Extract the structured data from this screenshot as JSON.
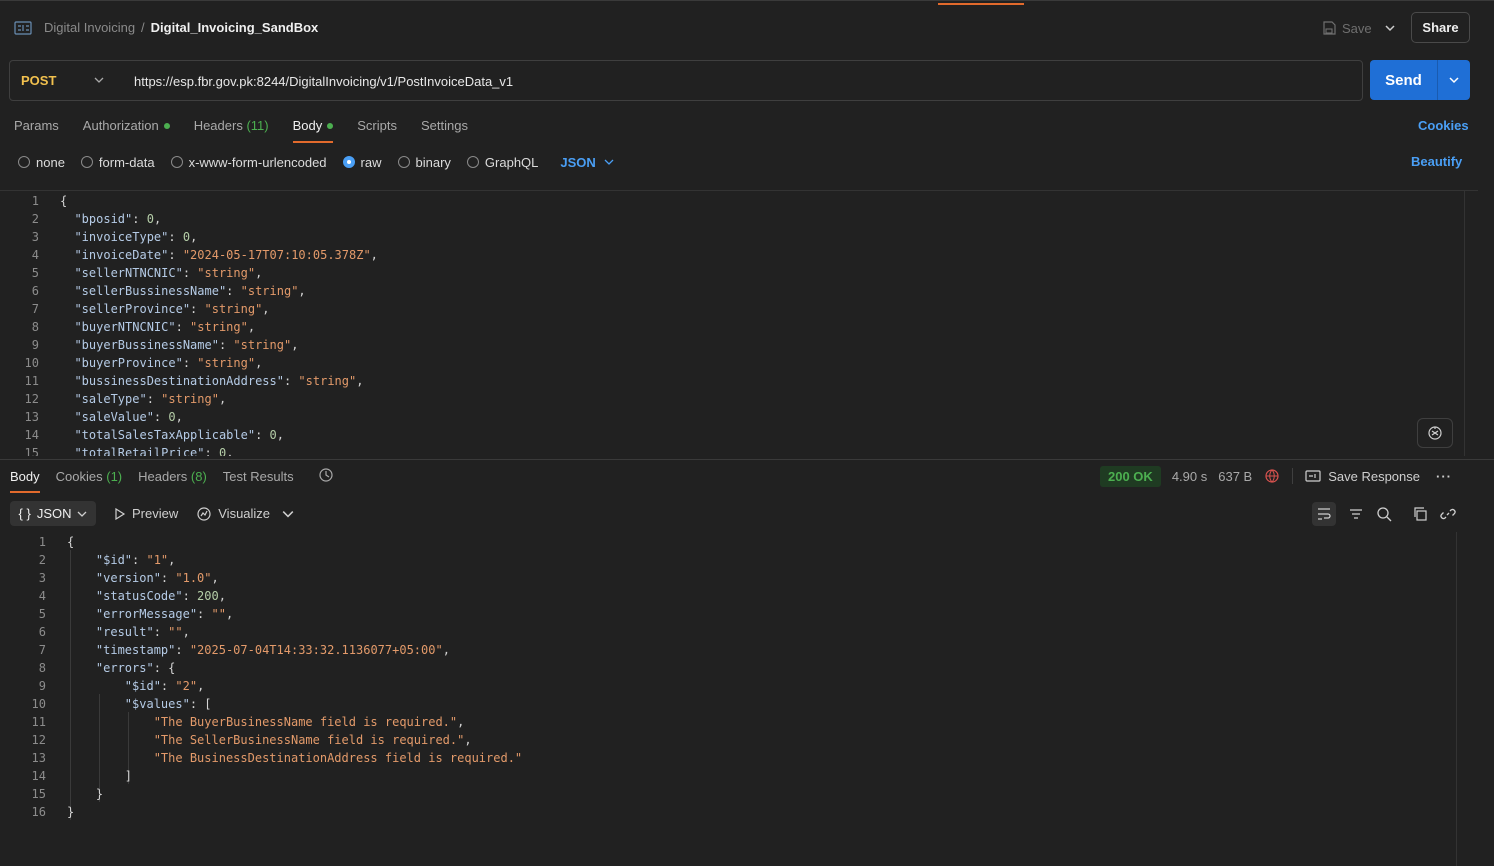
{
  "header": {
    "workspace": "Digital Invoicing",
    "separator": "/",
    "request_name": "Digital_Invoicing_SandBox",
    "save_label": "Save",
    "share_label": "Share"
  },
  "request": {
    "method": "POST",
    "url": "https://esp.fbr.gov.pk:8244/DigitalInvoicing/v1/PostInvoiceData_v1",
    "send_label": "Send"
  },
  "request_tabs": {
    "params": "Params",
    "authorization": "Authorization",
    "headers": "Headers",
    "headers_count": "(11)",
    "body": "Body",
    "scripts": "Scripts",
    "settings": "Settings",
    "cookies": "Cookies"
  },
  "body_types": {
    "none": "none",
    "form_data": "form-data",
    "urlencoded": "x-www-form-urlencoded",
    "raw": "raw",
    "binary": "binary",
    "graphql": "GraphQL",
    "selected": "raw",
    "format": "JSON",
    "beautify": "Beautify"
  },
  "request_body": [
    {
      "n": "1",
      "tokens": [
        [
          "p",
          "{"
        ]
      ]
    },
    {
      "n": "2",
      "tokens": [
        [
          "k",
          "  \"bposid\""
        ],
        [
          "p",
          ": "
        ],
        [
          "n",
          "0"
        ],
        [
          "p",
          ","
        ]
      ]
    },
    {
      "n": "3",
      "tokens": [
        [
          "k",
          "  \"invoiceType\""
        ],
        [
          "p",
          ": "
        ],
        [
          "n",
          "0"
        ],
        [
          "p",
          ","
        ]
      ]
    },
    {
      "n": "4",
      "tokens": [
        [
          "k",
          "  \"invoiceDate\""
        ],
        [
          "p",
          ": "
        ],
        [
          "s",
          "\"2024-05-17T07:10:05.378Z\""
        ],
        [
          "p",
          ","
        ]
      ]
    },
    {
      "n": "5",
      "tokens": [
        [
          "k",
          "  \"sellerNTNCNIC\""
        ],
        [
          "p",
          ": "
        ],
        [
          "s",
          "\"string\""
        ],
        [
          "p",
          ","
        ]
      ]
    },
    {
      "n": "6",
      "tokens": [
        [
          "k",
          "  \"sellerBussinessName\""
        ],
        [
          "p",
          ": "
        ],
        [
          "s",
          "\"string\""
        ],
        [
          "p",
          ","
        ]
      ]
    },
    {
      "n": "7",
      "tokens": [
        [
          "k",
          "  \"sellerProvince\""
        ],
        [
          "p",
          ": "
        ],
        [
          "s",
          "\"string\""
        ],
        [
          "p",
          ","
        ]
      ]
    },
    {
      "n": "8",
      "tokens": [
        [
          "k",
          "  \"buyerNTNCNIC\""
        ],
        [
          "p",
          ": "
        ],
        [
          "s",
          "\"string\""
        ],
        [
          "p",
          ","
        ]
      ]
    },
    {
      "n": "9",
      "tokens": [
        [
          "k",
          "  \"buyerBussinessName\""
        ],
        [
          "p",
          ": "
        ],
        [
          "s",
          "\"string\""
        ],
        [
          "p",
          ","
        ]
      ]
    },
    {
      "n": "10",
      "tokens": [
        [
          "k",
          "  \"buyerProvince\""
        ],
        [
          "p",
          ": "
        ],
        [
          "s",
          "\"string\""
        ],
        [
          "p",
          ","
        ]
      ]
    },
    {
      "n": "11",
      "tokens": [
        [
          "k",
          "  \"bussinessDestinationAddress\""
        ],
        [
          "p",
          ": "
        ],
        [
          "s",
          "\"string\""
        ],
        [
          "p",
          ","
        ]
      ]
    },
    {
      "n": "12",
      "tokens": [
        [
          "k",
          "  \"saleType\""
        ],
        [
          "p",
          ": "
        ],
        [
          "s",
          "\"string\""
        ],
        [
          "p",
          ","
        ]
      ]
    },
    {
      "n": "13",
      "tokens": [
        [
          "k",
          "  \"saleValue\""
        ],
        [
          "p",
          ": "
        ],
        [
          "n",
          "0"
        ],
        [
          "p",
          ","
        ]
      ]
    },
    {
      "n": "14",
      "tokens": [
        [
          "k",
          "  \"totalSalesTaxApplicable\""
        ],
        [
          "p",
          ": "
        ],
        [
          "n",
          "0"
        ],
        [
          "p",
          ","
        ]
      ]
    },
    {
      "n": "15",
      "tokens": [
        [
          "k",
          "  \"totalRetailPrice\""
        ],
        [
          "p",
          ": "
        ],
        [
          "n",
          "0"
        ],
        [
          "p",
          ","
        ]
      ]
    }
  ],
  "response": {
    "tabs": {
      "body": "Body",
      "cookies": "Cookies",
      "cookies_count": "(1)",
      "headers": "Headers",
      "headers_count": "(8)",
      "test_results": "Test Results"
    },
    "status": "200 OK",
    "time": "4.90 s",
    "size": "637 B",
    "save_response": "Save Response",
    "format": "JSON",
    "preview": "Preview",
    "visualize": "Visualize"
  },
  "response_body": [
    {
      "n": "1",
      "tokens": [
        [
          "p",
          "{"
        ]
      ]
    },
    {
      "n": "2",
      "tokens": [
        [
          "k",
          "    \"$id\""
        ],
        [
          "p",
          ": "
        ],
        [
          "s",
          "\"1\""
        ],
        [
          "p",
          ","
        ]
      ]
    },
    {
      "n": "3",
      "tokens": [
        [
          "k",
          "    \"version\""
        ],
        [
          "p",
          ": "
        ],
        [
          "s",
          "\"1.0\""
        ],
        [
          "p",
          ","
        ]
      ]
    },
    {
      "n": "4",
      "tokens": [
        [
          "k",
          "    \"statusCode\""
        ],
        [
          "p",
          ": "
        ],
        [
          "n",
          "200"
        ],
        [
          "p",
          ","
        ]
      ]
    },
    {
      "n": "5",
      "tokens": [
        [
          "k",
          "    \"errorMessage\""
        ],
        [
          "p",
          ": "
        ],
        [
          "s",
          "\"\""
        ],
        [
          "p",
          ","
        ]
      ]
    },
    {
      "n": "6",
      "tokens": [
        [
          "k",
          "    \"result\""
        ],
        [
          "p",
          ": "
        ],
        [
          "s",
          "\"\""
        ],
        [
          "p",
          ","
        ]
      ]
    },
    {
      "n": "7",
      "tokens": [
        [
          "k",
          "    \"timestamp\""
        ],
        [
          "p",
          ": "
        ],
        [
          "s",
          "\"2025-07-04T14:33:32.1136077+05:00\""
        ],
        [
          "p",
          ","
        ]
      ]
    },
    {
      "n": "8",
      "tokens": [
        [
          "k",
          "    \"errors\""
        ],
        [
          "p",
          ": {"
        ]
      ]
    },
    {
      "n": "9",
      "tokens": [
        [
          "k",
          "        \"$id\""
        ],
        [
          "p",
          ": "
        ],
        [
          "s",
          "\"2\""
        ],
        [
          "p",
          ","
        ]
      ]
    },
    {
      "n": "10",
      "tokens": [
        [
          "k",
          "        \"$values\""
        ],
        [
          "p",
          ": ["
        ]
      ]
    },
    {
      "n": "11",
      "tokens": [
        [
          "s",
          "            \"The BuyerBusinessName field is required.\""
        ],
        [
          "p",
          ","
        ]
      ]
    },
    {
      "n": "12",
      "tokens": [
        [
          "s",
          "            \"The SellerBusinessName field is required.\""
        ],
        [
          "p",
          ","
        ]
      ]
    },
    {
      "n": "13",
      "tokens": [
        [
          "s",
          "            \"The BusinessDestinationAddress field is required.\""
        ]
      ]
    },
    {
      "n": "14",
      "tokens": [
        [
          "p",
          "        ]"
        ]
      ]
    },
    {
      "n": "15",
      "tokens": [
        [
          "p",
          "    }"
        ]
      ]
    },
    {
      "n": "16",
      "tokens": [
        [
          "p",
          "}"
        ]
      ]
    }
  ],
  "colors": {
    "accent": "#e26a2c",
    "primary": "#1f6fd6",
    "link": "#4a9ff5",
    "success": "#4caf50",
    "method": "#f2c14e"
  }
}
